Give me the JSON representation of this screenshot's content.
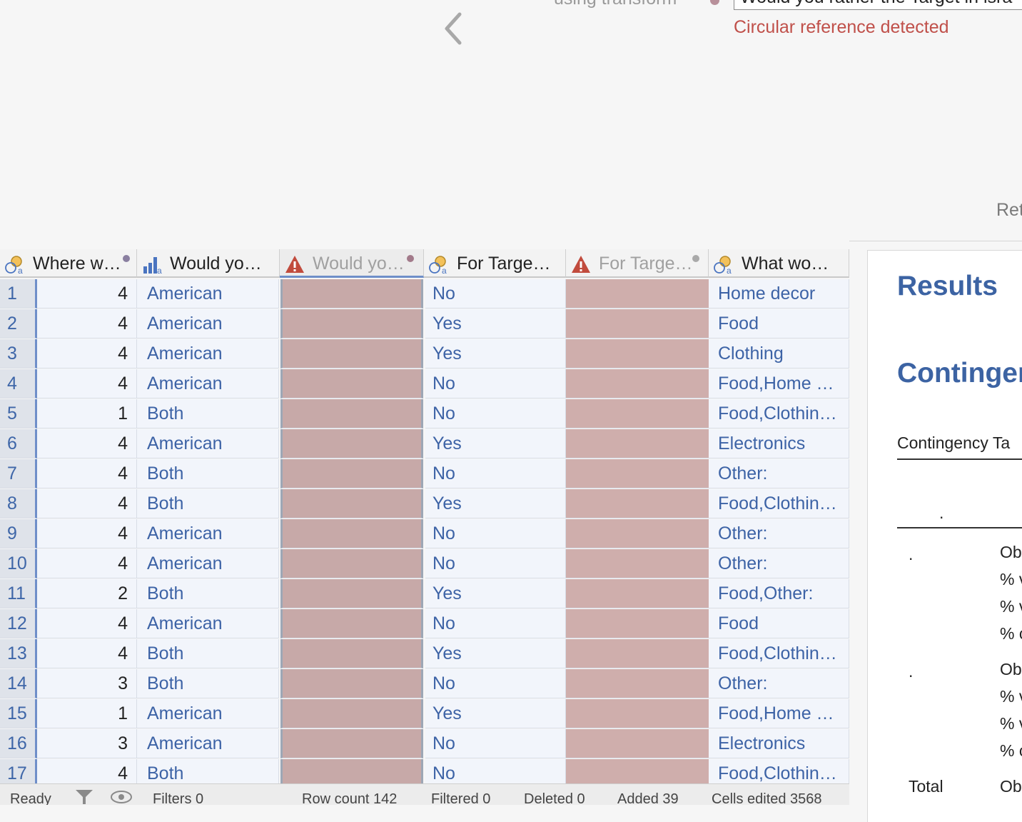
{
  "transform": {
    "using_label": "using transform",
    "formula_value": "Would you rather the Target in isra",
    "error": "Circular reference detected",
    "ret_label": "Ret"
  },
  "grid": {
    "columns": [
      {
        "label": "Where w…",
        "icon": "nominal-text-icon"
      },
      {
        "label": "Would yo…",
        "icon": "ordinal-bars-icon"
      },
      {
        "label": "Would yo…",
        "icon": "warning-icon"
      },
      {
        "label": "For Targe…",
        "icon": "nominal-text-icon"
      },
      {
        "label": "For Targe…",
        "icon": "warning-icon"
      },
      {
        "label": "What wo…",
        "icon": "nominal-text-icon"
      }
    ],
    "rows": [
      {
        "n": "1",
        "where": "4",
        "would": "American",
        "target": "No",
        "what": "Home decor"
      },
      {
        "n": "2",
        "where": "4",
        "would": "American",
        "target": "Yes",
        "what": "Food"
      },
      {
        "n": "3",
        "where": "4",
        "would": "American",
        "target": "Yes",
        "what": "Clothing"
      },
      {
        "n": "4",
        "where": "4",
        "would": "American",
        "target": "No",
        "what": "Food,Home …"
      },
      {
        "n": "5",
        "where": "1",
        "would": "Both",
        "target": "No",
        "what": "Food,Clothin…"
      },
      {
        "n": "6",
        "where": "4",
        "would": "American",
        "target": "Yes",
        "what": "Electronics"
      },
      {
        "n": "7",
        "where": "4",
        "would": "Both",
        "target": "No",
        "what": "Other:"
      },
      {
        "n": "8",
        "where": "4",
        "would": "Both",
        "target": "Yes",
        "what": "Food,Clothin…"
      },
      {
        "n": "9",
        "where": "4",
        "would": "American",
        "target": "No",
        "what": "Other:"
      },
      {
        "n": "10",
        "where": "4",
        "would": "American",
        "target": "No",
        "what": "Other:"
      },
      {
        "n": "11",
        "where": "2",
        "would": "Both",
        "target": "Yes",
        "what": "Food,Other:"
      },
      {
        "n": "12",
        "where": "4",
        "would": "American",
        "target": "No",
        "what": "Food"
      },
      {
        "n": "13",
        "where": "4",
        "would": "Both",
        "target": "Yes",
        "what": "Food,Clothin…"
      },
      {
        "n": "14",
        "where": "3",
        "would": "Both",
        "target": "No",
        "what": "Other:"
      },
      {
        "n": "15",
        "where": "1",
        "would": "American",
        "target": "Yes",
        "what": "Food,Home …"
      },
      {
        "n": "16",
        "where": "3",
        "would": "American",
        "target": "No",
        "what": "Electronics"
      },
      {
        "n": "17",
        "where": "4",
        "would": "Both",
        "target": "No",
        "what": "Food,Clothin…"
      }
    ]
  },
  "results": {
    "title": "Results",
    "section": "Contingen",
    "caption": "Contingency Ta",
    "header_dot": ".",
    "groups": [
      {
        "dot": ".",
        "lines": [
          "Ob",
          "% v",
          "% v",
          "% c"
        ]
      },
      {
        "dot": ".",
        "lines": [
          "Ob",
          "% v",
          "% v",
          "% c"
        ]
      }
    ],
    "total_label": "Total",
    "total_value": "Ob"
  },
  "status": {
    "ready": "Ready",
    "filters": "Filters 0",
    "row_count": "Row count 142",
    "filtered": "Filtered 0",
    "deleted": "Deleted 0",
    "added": "Added 39",
    "cells_edited": "Cells edited 3568"
  },
  "colors": {
    "accent": "#3c63a3",
    "error": "#c0504a",
    "broken_column": "#c7a9a8"
  }
}
